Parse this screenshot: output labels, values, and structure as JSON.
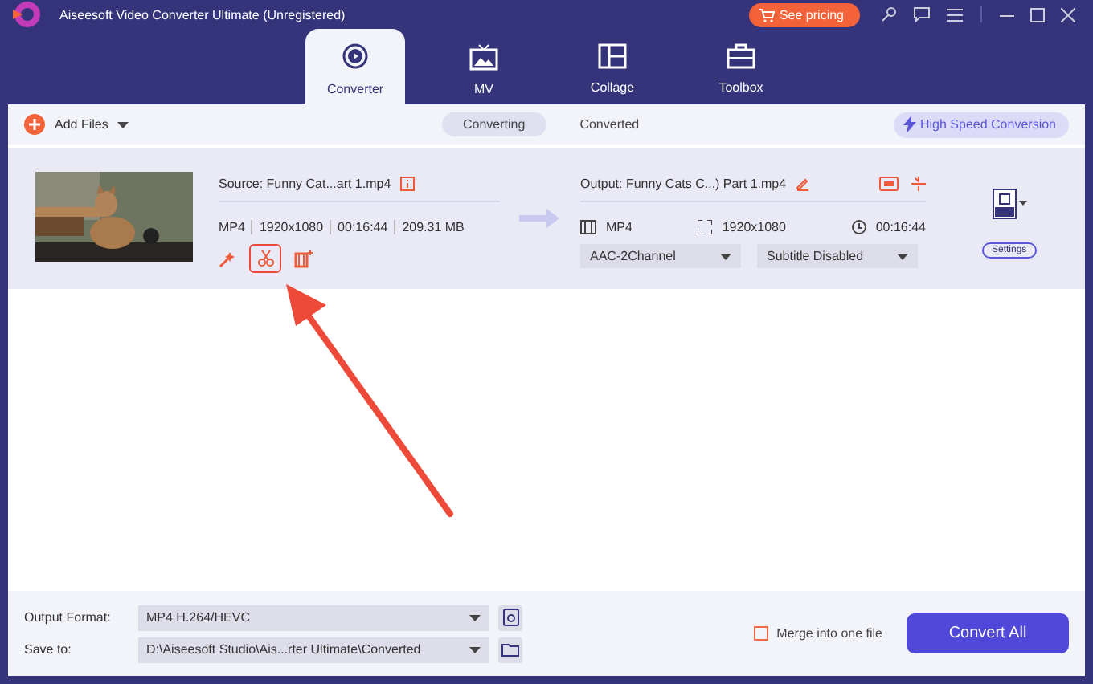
{
  "window": {
    "title": "Aiseesoft Video Converter Ultimate (Unregistered)",
    "pricing_button": "See pricing"
  },
  "tabs": [
    {
      "label": "Converter",
      "selected": true
    },
    {
      "label": "MV",
      "selected": false
    },
    {
      "label": "Collage",
      "selected": false
    },
    {
      "label": "Toolbox",
      "selected": false
    }
  ],
  "toolbar": {
    "add_files": "Add Files",
    "views": [
      {
        "label": "Converting",
        "selected": true
      },
      {
        "label": "Converted",
        "selected": false
      }
    ],
    "high_speed": "High Speed Conversion"
  },
  "files": [
    {
      "source": "Source: Funny Cat...art 1.mp4",
      "format": "MP4",
      "resolution": "1920x1080",
      "duration": "00:16:44",
      "size": "209.31 MB",
      "output": "Output: Funny Cats C...) Part 1.mp4",
      "output_format": "MP4",
      "output_resolution": "1920x1080",
      "output_duration": "00:16:44",
      "audio": "AAC-2Channel",
      "subtitle": "Subtitle Disabled",
      "settings": "Settings",
      "cut_highlighted": true
    }
  ],
  "bottom": {
    "output_format_label": "Output Format:",
    "output_format": "MP4 H.264/HEVC",
    "save_to_label": "Save to:",
    "save_to": "D:\\Aiseesoft Studio\\Ais...rter Ultimate\\Converted",
    "merge": {
      "label": "Merge into one file",
      "checked": false
    },
    "convert_all": "Convert All"
  }
}
